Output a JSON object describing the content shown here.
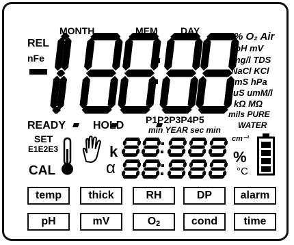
{
  "annunciators": {
    "month": "MONTH",
    "mem": "MEM",
    "day": "DAY",
    "rel": "REL",
    "nfe": "nFe",
    "ready": "READY",
    "hold": "HOLD",
    "set": "SET",
    "e_codes": "E1E2E3",
    "cal": "CAL",
    "programs": "P1P2P3P4P5",
    "time_units": "min  YEAR sec min",
    "k": "k",
    "alpha": "α"
  },
  "units": {
    "line1": "% O₂  Air",
    "line2": "pH  mV",
    "line3": "mg/l  TDS",
    "line4": "NaCl  KCl",
    "line5": "mS  hPa",
    "line6": "uS umM/l",
    "line7": "kΩ  MΩ",
    "line8": "mils PURE",
    "line9": "WATER",
    "cm_inv": "cm⁻¹",
    "percent": "%",
    "celsius": "°C"
  },
  "keys": {
    "row1": [
      "temp",
      "thick",
      "RH",
      "DP",
      "alarm"
    ],
    "row2_a": "pH",
    "row2_b": "mV",
    "row2_c_base": "O",
    "row2_c_sub": "2",
    "row2_d": "cond",
    "row2_e": "time"
  },
  "icons": {
    "thermometer": "thermometer-icon",
    "hand": "hand-icon",
    "battery": "battery-icon"
  },
  "colors": {
    "segment": "#000000",
    "background": "#ffffff"
  }
}
